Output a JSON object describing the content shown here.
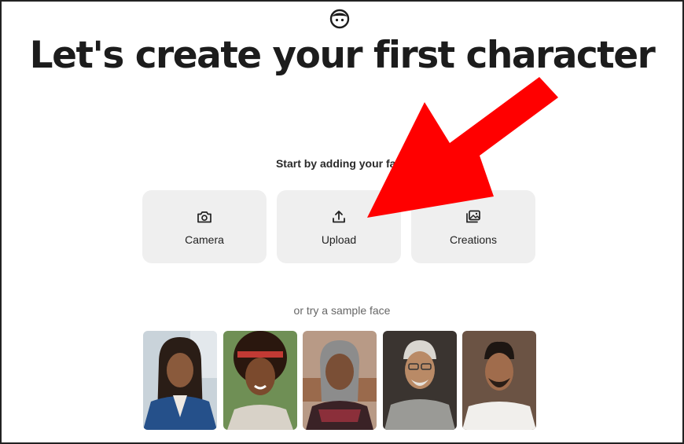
{
  "header": {
    "logo_icon": "smiley-face-icon",
    "title": "Let's create your first character"
  },
  "subtitle": "Start by adding your face",
  "options": [
    {
      "label": "Camera",
      "icon": "camera-icon"
    },
    {
      "label": "Upload",
      "icon": "upload-icon"
    },
    {
      "label": "Creations",
      "icon": "gallery-icon"
    }
  ],
  "samples": {
    "label": "or try a sample face",
    "faces": [
      {
        "name": "sample-face-1"
      },
      {
        "name": "sample-face-2"
      },
      {
        "name": "sample-face-3"
      },
      {
        "name": "sample-face-4"
      },
      {
        "name": "sample-face-5"
      }
    ]
  },
  "annotation": {
    "icon": "red-arrow-annotation",
    "color": "#ff0000"
  }
}
